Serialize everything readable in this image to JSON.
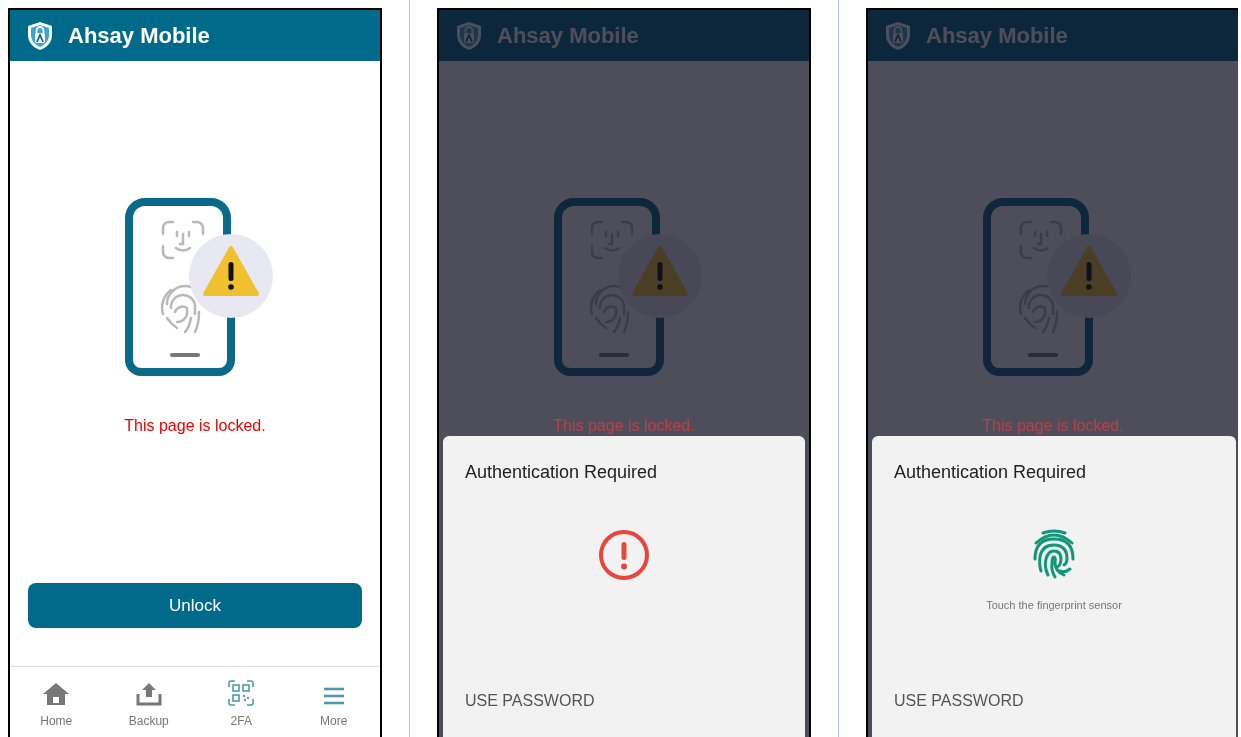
{
  "screens": [
    {
      "dimmed": false,
      "app_title": "Ahsay Mobile",
      "locked_message": "This page is locked.",
      "unlock_button": "Unlock",
      "nav": [
        {
          "label": "Home",
          "kind": "home"
        },
        {
          "label": "Backup",
          "kind": "backup"
        },
        {
          "label": "2FA",
          "kind": "qr"
        },
        {
          "label": "More",
          "kind": "menu"
        }
      ]
    },
    {
      "dimmed": true,
      "app_title": "Ahsay Mobile",
      "locked_message": "This page is locked.",
      "dialog": {
        "title": "Authentication Required",
        "kind": "error",
        "button": "USE PASSWORD"
      }
    },
    {
      "dimmed": true,
      "app_title": "Ahsay Mobile",
      "locked_message": "This page is locked.",
      "dialog": {
        "title": "Authentication Required",
        "kind": "fingerprint",
        "hint": "Touch the fingerprint sensor",
        "button": "USE PASSWORD"
      }
    }
  ]
}
